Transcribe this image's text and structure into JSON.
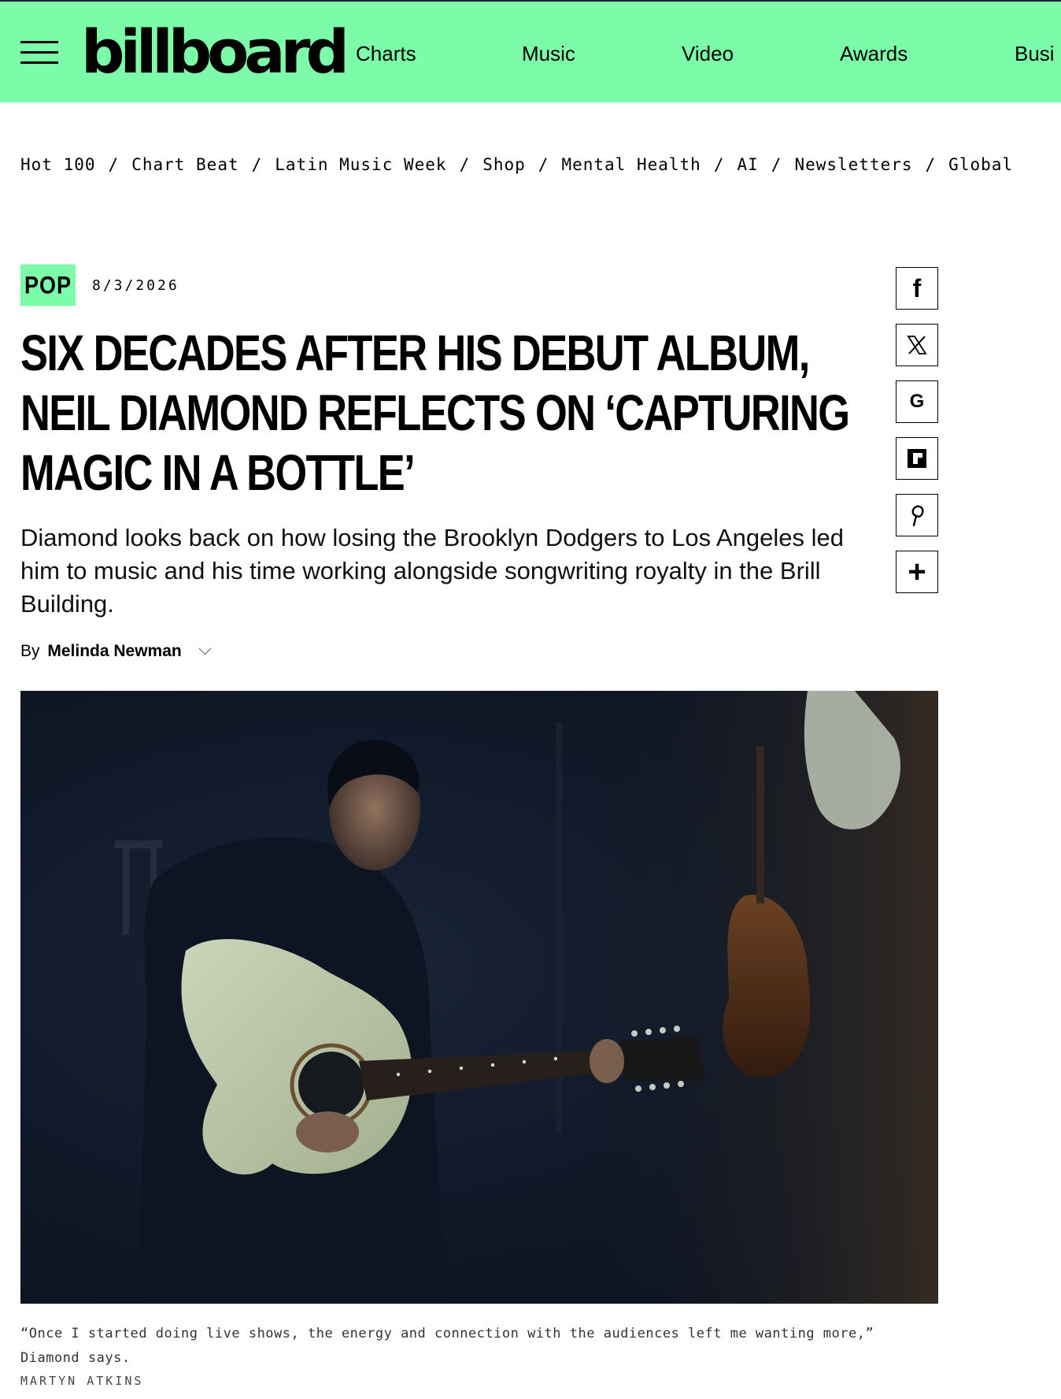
{
  "header": {
    "logo_text": "billboard",
    "nav": [
      "Charts",
      "Music",
      "Video",
      "Awards",
      "Busi"
    ],
    "brand_color": "#7cfca8"
  },
  "subnav": {
    "items": [
      "Hot 100",
      "Chart Beat",
      "Latin Music Week",
      "Shop",
      "Mental Health",
      "AI",
      "Newsletters",
      "Global"
    ],
    "separator": "/"
  },
  "article": {
    "category": "POP",
    "date": "8/3/2026",
    "headline": "Six Decades After His Debut Album, Neil Diamond Reflects On ‘Capturing Magic in a Bottle’",
    "dek": "Diamond looks back on how losing the Brooklyn Dodgers to Los Angeles led him to music and his time working alongside songwriting royalty in the Brill Building.",
    "byline_prefix": "By",
    "author": "Melinda Newman",
    "caption": "“Once I started doing live shows, the energy and connection with the audiences left me wanting more,” Diamond says.",
    "credit": "MARTYN ATKINS"
  },
  "share": {
    "icons": [
      "facebook-icon",
      "x-icon",
      "google-icon",
      "flipboard-icon",
      "pinterest-icon",
      "plus-icon"
    ],
    "glyphs": [
      "f",
      "𝕏",
      "G",
      "",
      "p",
      "+"
    ]
  }
}
